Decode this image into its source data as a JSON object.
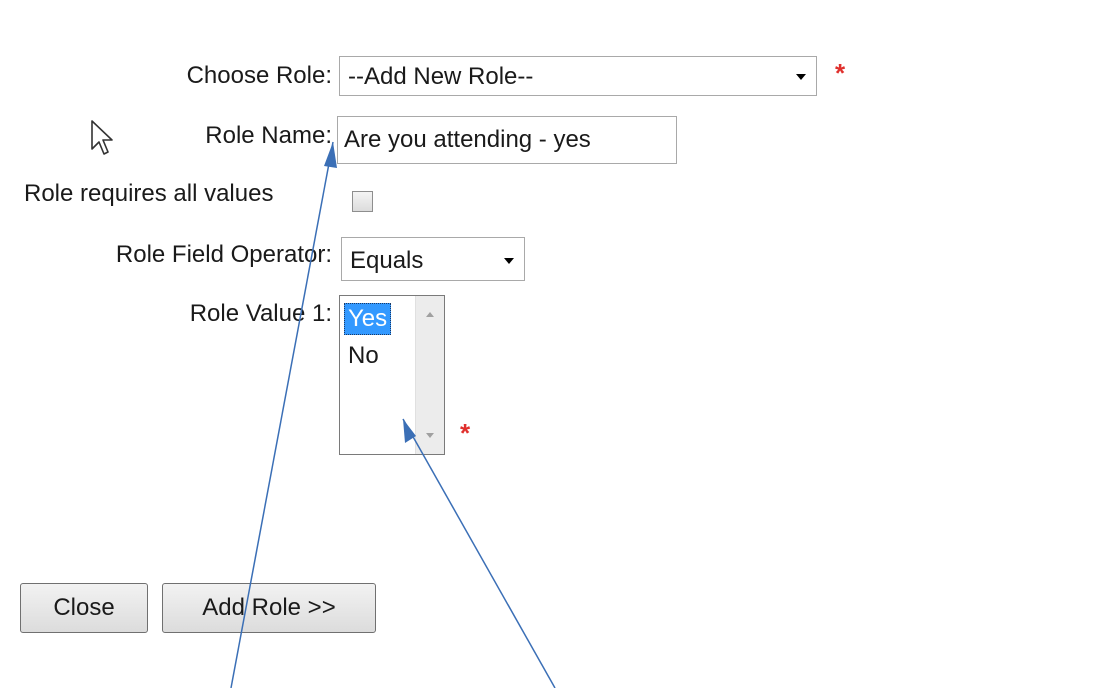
{
  "form": {
    "choose_role": {
      "label": "Choose Role:",
      "value": "--Add New Role--",
      "required_mark": "*"
    },
    "role_name": {
      "label": "Role Name:",
      "value": "Are you attending - yes"
    },
    "role_requires_all": {
      "label": "Role requires all values",
      "checked": false
    },
    "role_field_operator": {
      "label": "Role Field Operator:",
      "value": "Equals"
    },
    "role_value_1": {
      "label": "Role Value 1:",
      "options": [
        "Yes",
        "No"
      ],
      "selected": "Yes",
      "required_mark": "*"
    }
  },
  "buttons": {
    "close": "Close",
    "add_role": "Add Role >>"
  },
  "colors": {
    "required": "#e0302d",
    "selection": "#3399ff",
    "annotation_arrow": "#3b6fb6"
  }
}
